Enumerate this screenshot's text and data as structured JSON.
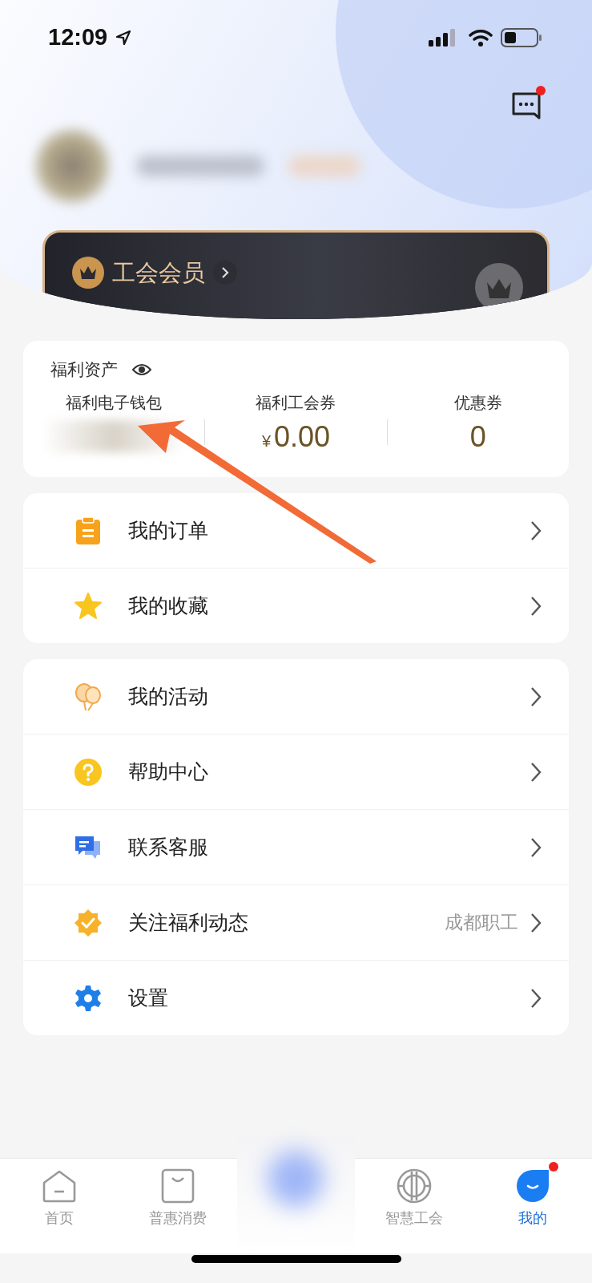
{
  "status_bar": {
    "time": "12:09"
  },
  "header": {
    "message_unread": true,
    "member_label": "工会会员"
  },
  "assets": {
    "title": "福利资产",
    "items": [
      {
        "kind": "hidden",
        "label": "福利电子钱包"
      },
      {
        "kind": "money",
        "label": "福利工会券",
        "currency": "¥",
        "value": "0.00"
      },
      {
        "kind": "count",
        "label": "优惠券",
        "value": "0"
      }
    ]
  },
  "menu_groups": [
    {
      "items": [
        {
          "kind": "order",
          "label": "我的订单"
        },
        {
          "kind": "star",
          "label": "我的收藏"
        }
      ]
    },
    {
      "items": [
        {
          "kind": "balloon",
          "label": "我的活动"
        },
        {
          "kind": "help",
          "label": "帮助中心"
        },
        {
          "kind": "service",
          "label": "联系客服"
        },
        {
          "kind": "verified",
          "label": "关注福利动态",
          "detail": "成都职工"
        },
        {
          "kind": "settings",
          "label": "设置"
        }
      ]
    }
  ],
  "tabs": [
    {
      "kind": "home",
      "label": "首页",
      "selected": false,
      "badge": false
    },
    {
      "kind": "bag",
      "label": "普惠消费",
      "selected": false,
      "badge": false
    },
    {
      "kind": "blurred",
      "selected": false,
      "badge": false
    },
    {
      "kind": "union",
      "label": "智慧工会",
      "selected": false,
      "badge": false
    },
    {
      "kind": "me",
      "label": "我的",
      "selected": true,
      "badge": true
    }
  ]
}
